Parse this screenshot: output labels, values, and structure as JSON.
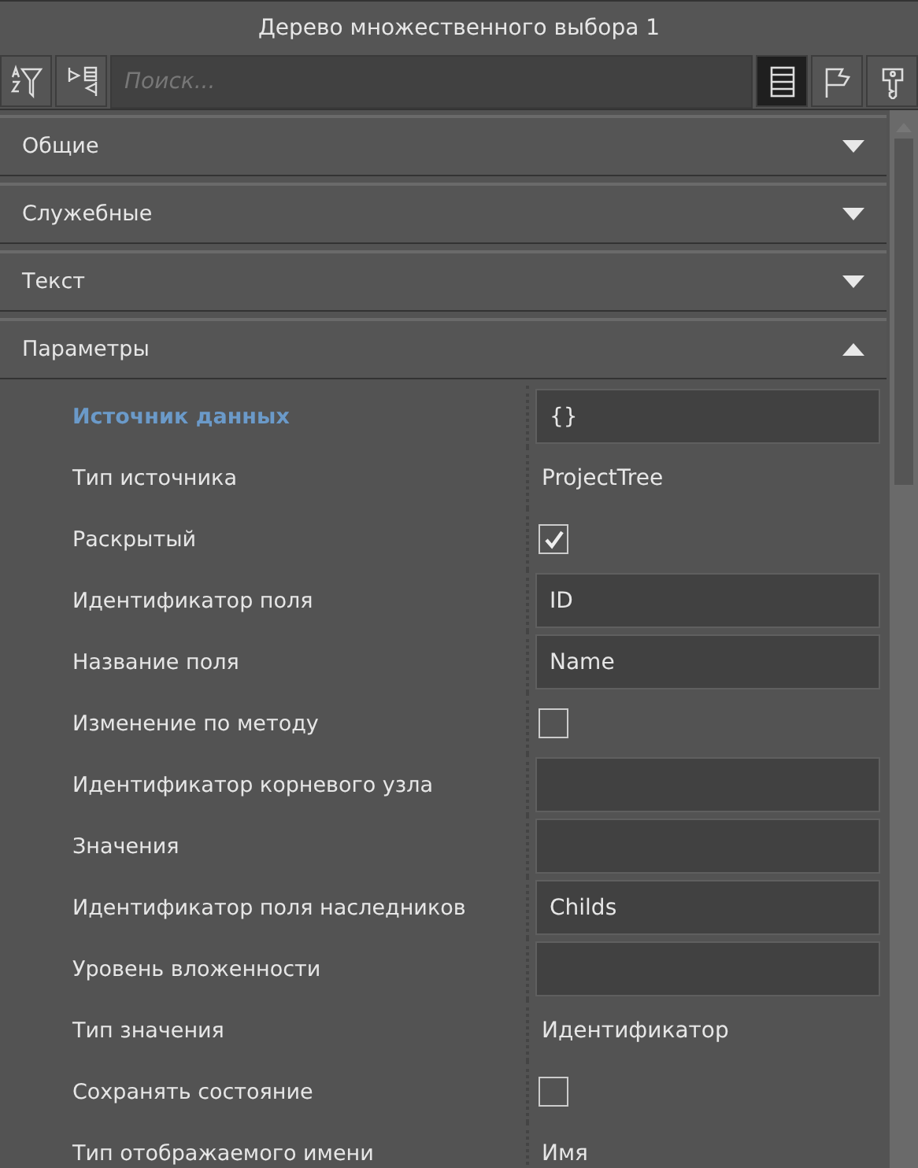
{
  "window": {
    "title": "Дерево множественного выбора 1"
  },
  "toolbar": {
    "left_buttons": [
      {
        "kind": "sort-filter"
      },
      {
        "kind": "move"
      }
    ],
    "search": {
      "placeholder": "Поиск..."
    },
    "right_buttons": [
      {
        "kind": "list",
        "selected": true
      },
      {
        "kind": "flag",
        "selected": false
      },
      {
        "kind": "key",
        "selected": false
      }
    ]
  },
  "sections": [
    {
      "title": "Общие",
      "expanded": false
    },
    {
      "title": "Служебные",
      "expanded": false
    },
    {
      "title": "Текст",
      "expanded": false
    },
    {
      "title": "Параметры",
      "expanded": true
    }
  ],
  "properties": [
    {
      "label": "Источник данных",
      "selected": true,
      "kind": "field",
      "value": "{}"
    },
    {
      "label": "Тип источника",
      "selected": false,
      "kind": "text",
      "value": "ProjectTree"
    },
    {
      "label": "Раскрытый",
      "selected": false,
      "kind": "check",
      "checked": true
    },
    {
      "label": "Идентификатор поля",
      "selected": false,
      "kind": "field",
      "value": "ID"
    },
    {
      "label": "Название поля",
      "selected": false,
      "kind": "field",
      "value": "Name"
    },
    {
      "label": "Изменение по методу",
      "selected": false,
      "kind": "check",
      "checked": false
    },
    {
      "label": "Идентификатор корневого узла",
      "selected": false,
      "kind": "field"
    },
    {
      "label": "Значения",
      "selected": false,
      "kind": "field"
    },
    {
      "label": "Идентификатор поля наследников",
      "selected": false,
      "kind": "field",
      "value": "Childs"
    },
    {
      "label": "Уровень вложенности",
      "selected": false,
      "kind": "field"
    },
    {
      "label": "Тип значения",
      "selected": false,
      "kind": "text",
      "value": "Идентификатор"
    },
    {
      "label": "Сохранять состояние",
      "selected": false,
      "kind": "check",
      "checked": false
    },
    {
      "label": "Тип отображаемого имени",
      "selected": false,
      "kind": "text",
      "value": "Имя"
    }
  ]
}
